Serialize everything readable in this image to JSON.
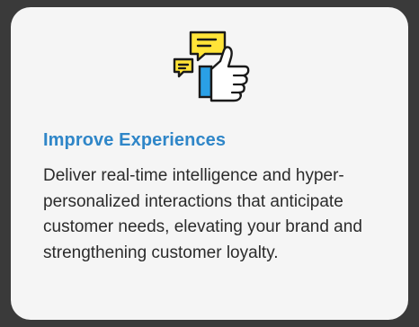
{
  "card": {
    "title": "Improve Experiences",
    "body": "Deliver real-time intelligence and hyper-personalized interactions that anticipate customer needs, elevating your brand and strengthening customer loyalty.",
    "icon": "chat-thumbs-up-icon"
  },
  "colors": {
    "title": "#2f86c8",
    "body_text": "#2b2b2b",
    "card_bg": "#f5f5f5",
    "page_bg": "#3a3a3a",
    "bubble_yellow": "#ffe438",
    "cuff_blue": "#2aa0e6",
    "outline": "#1a1a1a"
  }
}
